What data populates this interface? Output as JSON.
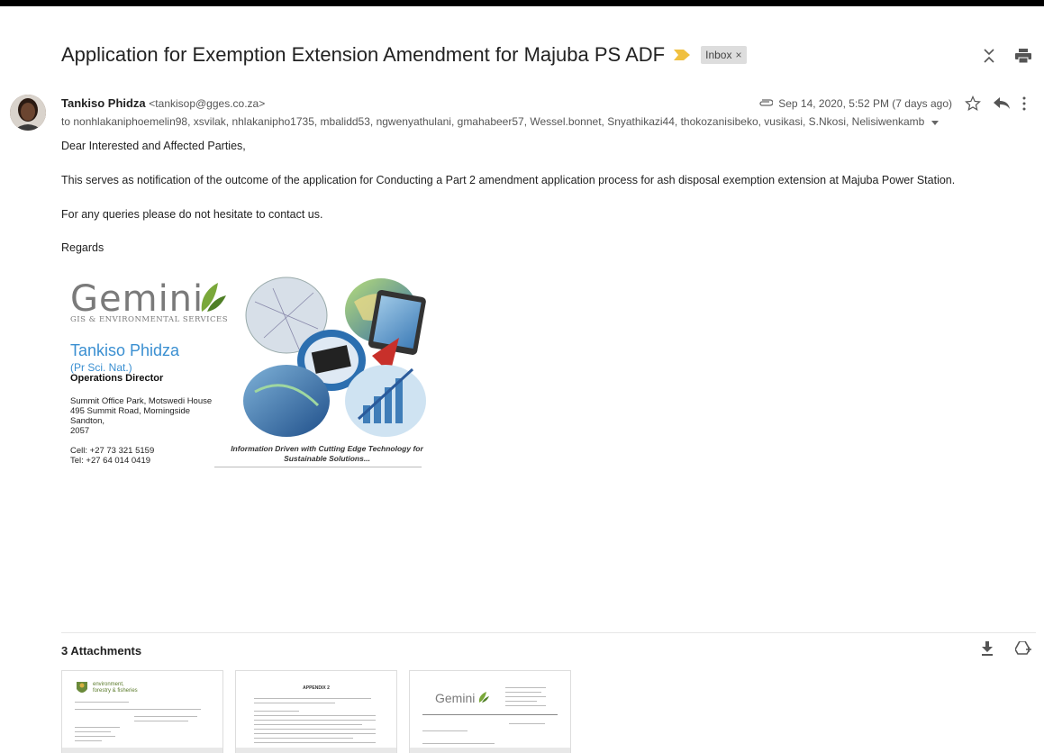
{
  "subject": "Application for Exemption Extension Amendment for Majuba PS ADF",
  "label": {
    "name": "Inbox",
    "remove": "×"
  },
  "sender": {
    "name": "Tankiso Phidza",
    "email": "<tankisop@gges.co.za>"
  },
  "date": "Sep 14, 2020, 5:52 PM (7 days ago)",
  "recipients": "to nonhlakaniphoemelin98, xsvilak, nhlakanipho1735, mbalidd53, ngwenyathulani, gmahabeer57, Wessel.bonnet, Snyathikazi44, thokozanisibeko, vusikasi, S.Nkosi, Nelisiwenkamb",
  "body": {
    "greeting": "Dear Interested and Affected Parties,",
    "paragraph1": "This serves as notification of the outcome of the application for Conducting a Part 2 amendment application process for ash disposal exemption extension at Majuba Power Station.",
    "paragraph2": "For any queries please do not hesitate to contact us.",
    "closing": "Regards"
  },
  "signature": {
    "logo": "Gemini",
    "logo_sub": "GIS & ENVIRONMENTAL SERVICES",
    "name": "Tankiso Phidza",
    "credential": "(Pr Sci. Nat.)",
    "role": "Operations Director",
    "address1": "Summit Office Park, Motswedi House",
    "address2": "495 Summit Road, Morningside",
    "address3": "Sandton,",
    "address4": "2057",
    "cell": "Cell: +27 73 321 5159",
    "tel": "Tel: +27 64 014 0419",
    "tagline1": "Information Driven with Cutting Edge Technology for",
    "tagline2": "Sustainable Solutions..."
  },
  "attachments": {
    "title": "3 Attachments",
    "items": [
      {
        "preview": "environment, forestry & fisheries"
      },
      {
        "preview": "APPENDIX 2"
      },
      {
        "preview": "Gemini"
      }
    ]
  },
  "colors": {
    "accent_blue": "#3a8fd1",
    "logo_grey": "#7a7a7a",
    "logo_green": "#6a9a3a",
    "importance": "#f0c040"
  },
  "icons": [
    "expand-collapse-icon",
    "print-icon",
    "paperclip-icon",
    "star-icon",
    "reply-icon",
    "more-vert-icon",
    "dropdown-icon",
    "download-icon",
    "save-to-drive-icon"
  ]
}
